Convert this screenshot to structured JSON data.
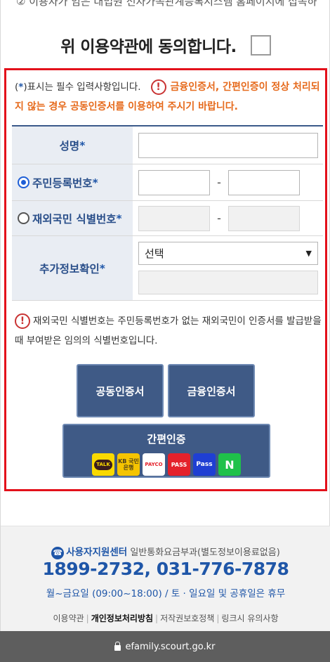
{
  "top_cut_text": "② 이용자가 임은 대법원 전자가족관계등록시스템 홈페이지에 접속하",
  "agree": {
    "label": "위 이용약관에 동의합니다."
  },
  "notices": {
    "required_prefix": "(",
    "required_star": "*",
    "required_suffix": ")표시는 필수 입력사항입니다.",
    "warning": "금융인증서, 간편인증이 정상 처리되지 않는 경우 공동인증서를 이용하여 주시기 바랍니다.",
    "foreign_id_info": "재외국민 식별번호는 주민등록번호가 없는 재외국민이 인증서를 발급받을 때 부여받은 임의의 식별번호입니다."
  },
  "form": {
    "name_label": "성명",
    "resident_label": "주민등록번호",
    "foreign_label": "재외국민 식별번호",
    "extra_label": "추가정보확인",
    "star": "*",
    "dash": "-",
    "select_value": "선택"
  },
  "buttons": {
    "gongdong": "공동인증서",
    "geumyung": "금융인증서",
    "simple": "간편인증"
  },
  "simple_logos": [
    {
      "name": "kakao",
      "label": "TALK"
    },
    {
      "name": "kb",
      "label": "KB 국민은행"
    },
    {
      "name": "payco",
      "label": "PAYCO"
    },
    {
      "name": "pass",
      "label": "PASS"
    },
    {
      "name": "samsung",
      "label": "Pass"
    },
    {
      "name": "naver",
      "label": "N"
    }
  ],
  "footer": {
    "center_name": "사용자지원센터",
    "center_note": "일반통화요금부과(별도정보이용료없음)",
    "phones": "1899-2732, 031-776-7878",
    "hours": "월~금요일 (09:00~18:00) / 토 · 일요일 및 공휴일은 휴무",
    "links": [
      "이용약관",
      "개인정보처리방침",
      "저작권보호정책",
      "링크시 유의사항"
    ]
  },
  "browser": {
    "url": "efamily.scourt.go.kr"
  },
  "colors": {
    "accent": "#1f56a8",
    "button": "#3f5a86",
    "warning": "#e66a1c",
    "frame": "#e3111b"
  }
}
